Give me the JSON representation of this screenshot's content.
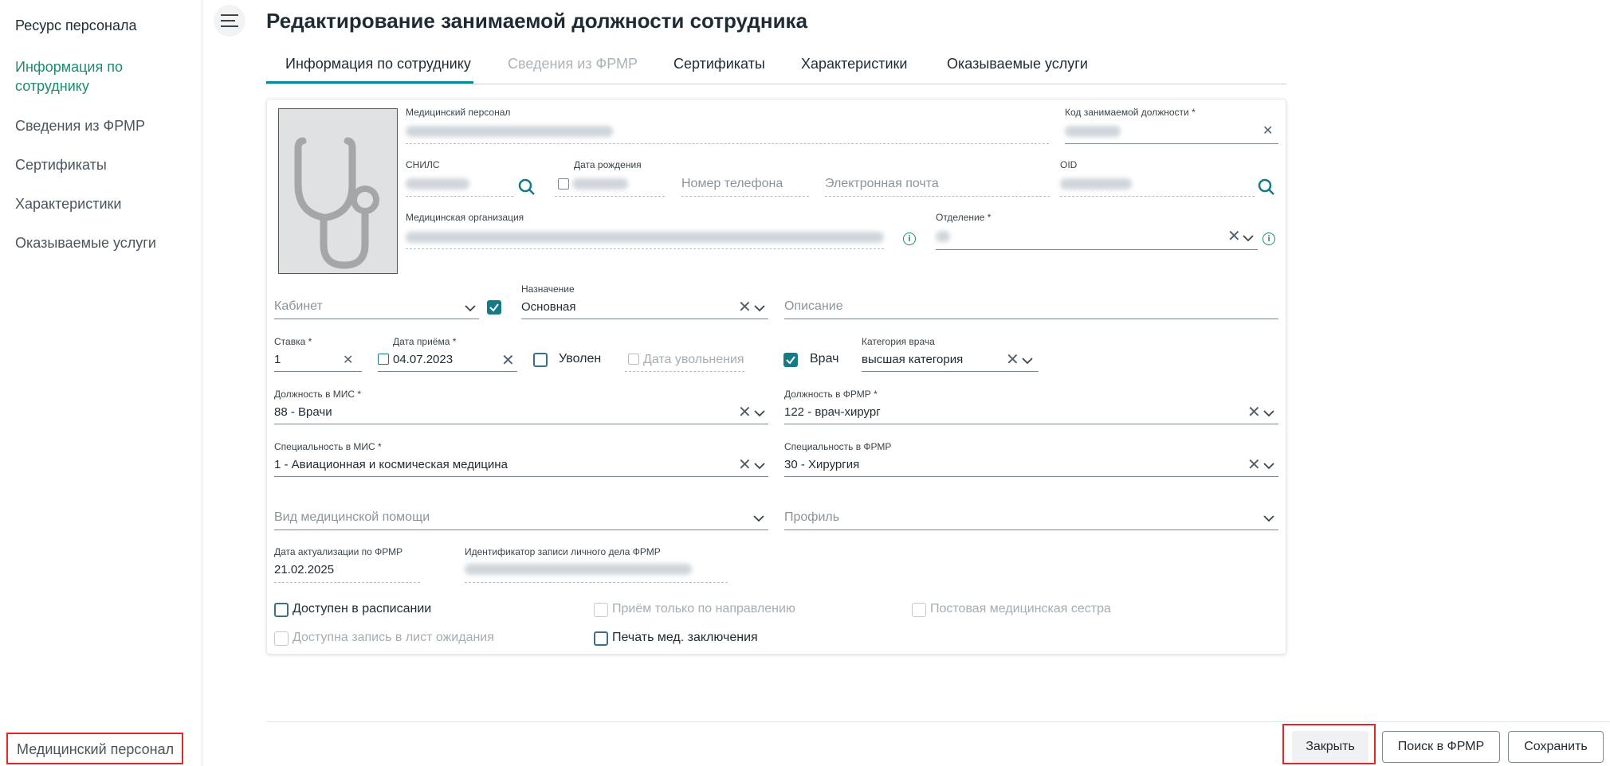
{
  "sidebar": {
    "title": "Ресурс персонала",
    "items": [
      {
        "label": "Информация по сотруднику",
        "active": true
      },
      {
        "label": "Сведения из ФРМР"
      },
      {
        "label": "Сертификаты"
      },
      {
        "label": "Характеристики"
      },
      {
        "label": "Оказываемые услуги"
      }
    ],
    "bottom_link": "Медицинский персонал"
  },
  "header": {
    "title": "Редактирование занимаемой должности сотрудника"
  },
  "tabs": [
    {
      "label": "Информация по сотруднику",
      "active": true
    },
    {
      "label": "Сведения из ФРМР",
      "disabled": true
    },
    {
      "label": "Сертификаты"
    },
    {
      "label": "Характеристики"
    },
    {
      "label": "Оказываемые услуги"
    }
  ],
  "form": {
    "medical_staff_label": "Медицинский персонал",
    "position_code_label": "Код занимаемой должности *",
    "snils_label": "СНИЛС",
    "birth_date_label": "Дата рождения",
    "phone_placeholder": "Номер телефона",
    "email_placeholder": "Электронная почта",
    "oid_label": "OID",
    "med_org_label": "Медицинская организация",
    "department_label": "Отделение *",
    "cabinet_placeholder": "Кабинет",
    "purpose_label": "Назначение",
    "purpose_value": "Основная",
    "description_placeholder": "Описание",
    "rate_label": "Ставка *",
    "rate_value": "1",
    "hire_date_label": "Дата приёма *",
    "hire_date_value": "04.07.2023",
    "fired_label": "Уволен",
    "fire_date_placeholder": "Дата увольнения",
    "doctor_label": "Врач",
    "doctor_category_label": "Категория врача",
    "doctor_category_value": "высшая категория",
    "mis_position_label": "Должность в МИС *",
    "mis_position_value": "88 - Врачи",
    "frmr_position_label": "Должность в ФРМР *",
    "frmr_position_value": "122 - врач-хирург",
    "mis_specialty_label": "Специальность в МИС *",
    "mis_specialty_value": "1 - Авиационная и космическая медицина",
    "frmr_specialty_label": "Специальность в ФРМР",
    "frmr_specialty_value": "30 - Хирургия",
    "care_type_placeholder": "Вид медицинской помощи",
    "profile_placeholder": "Профиль",
    "frmr_update_label": "Дата актуализации по ФРМР",
    "frmr_update_value": "21.02.2025",
    "frmr_record_id_label": "Идентификатор записи личного дела ФРМР",
    "checkboxes": {
      "available_schedule": "Доступен в расписании",
      "referral_only": "Приём только по направлению",
      "ward_nurse": "Постовая медицинская сестра",
      "waiting_list": "Доступна запись в лист ожидания",
      "print_conclusions": "Печать мед. заключения"
    }
  },
  "footer": {
    "close": "Закрыть",
    "search_frmr": "Поиск в ФРМР",
    "save": "Сохранить"
  },
  "colors": {
    "accent": "#147a86",
    "active_text": "#1d8d6f",
    "highlight": "#e3262b"
  }
}
